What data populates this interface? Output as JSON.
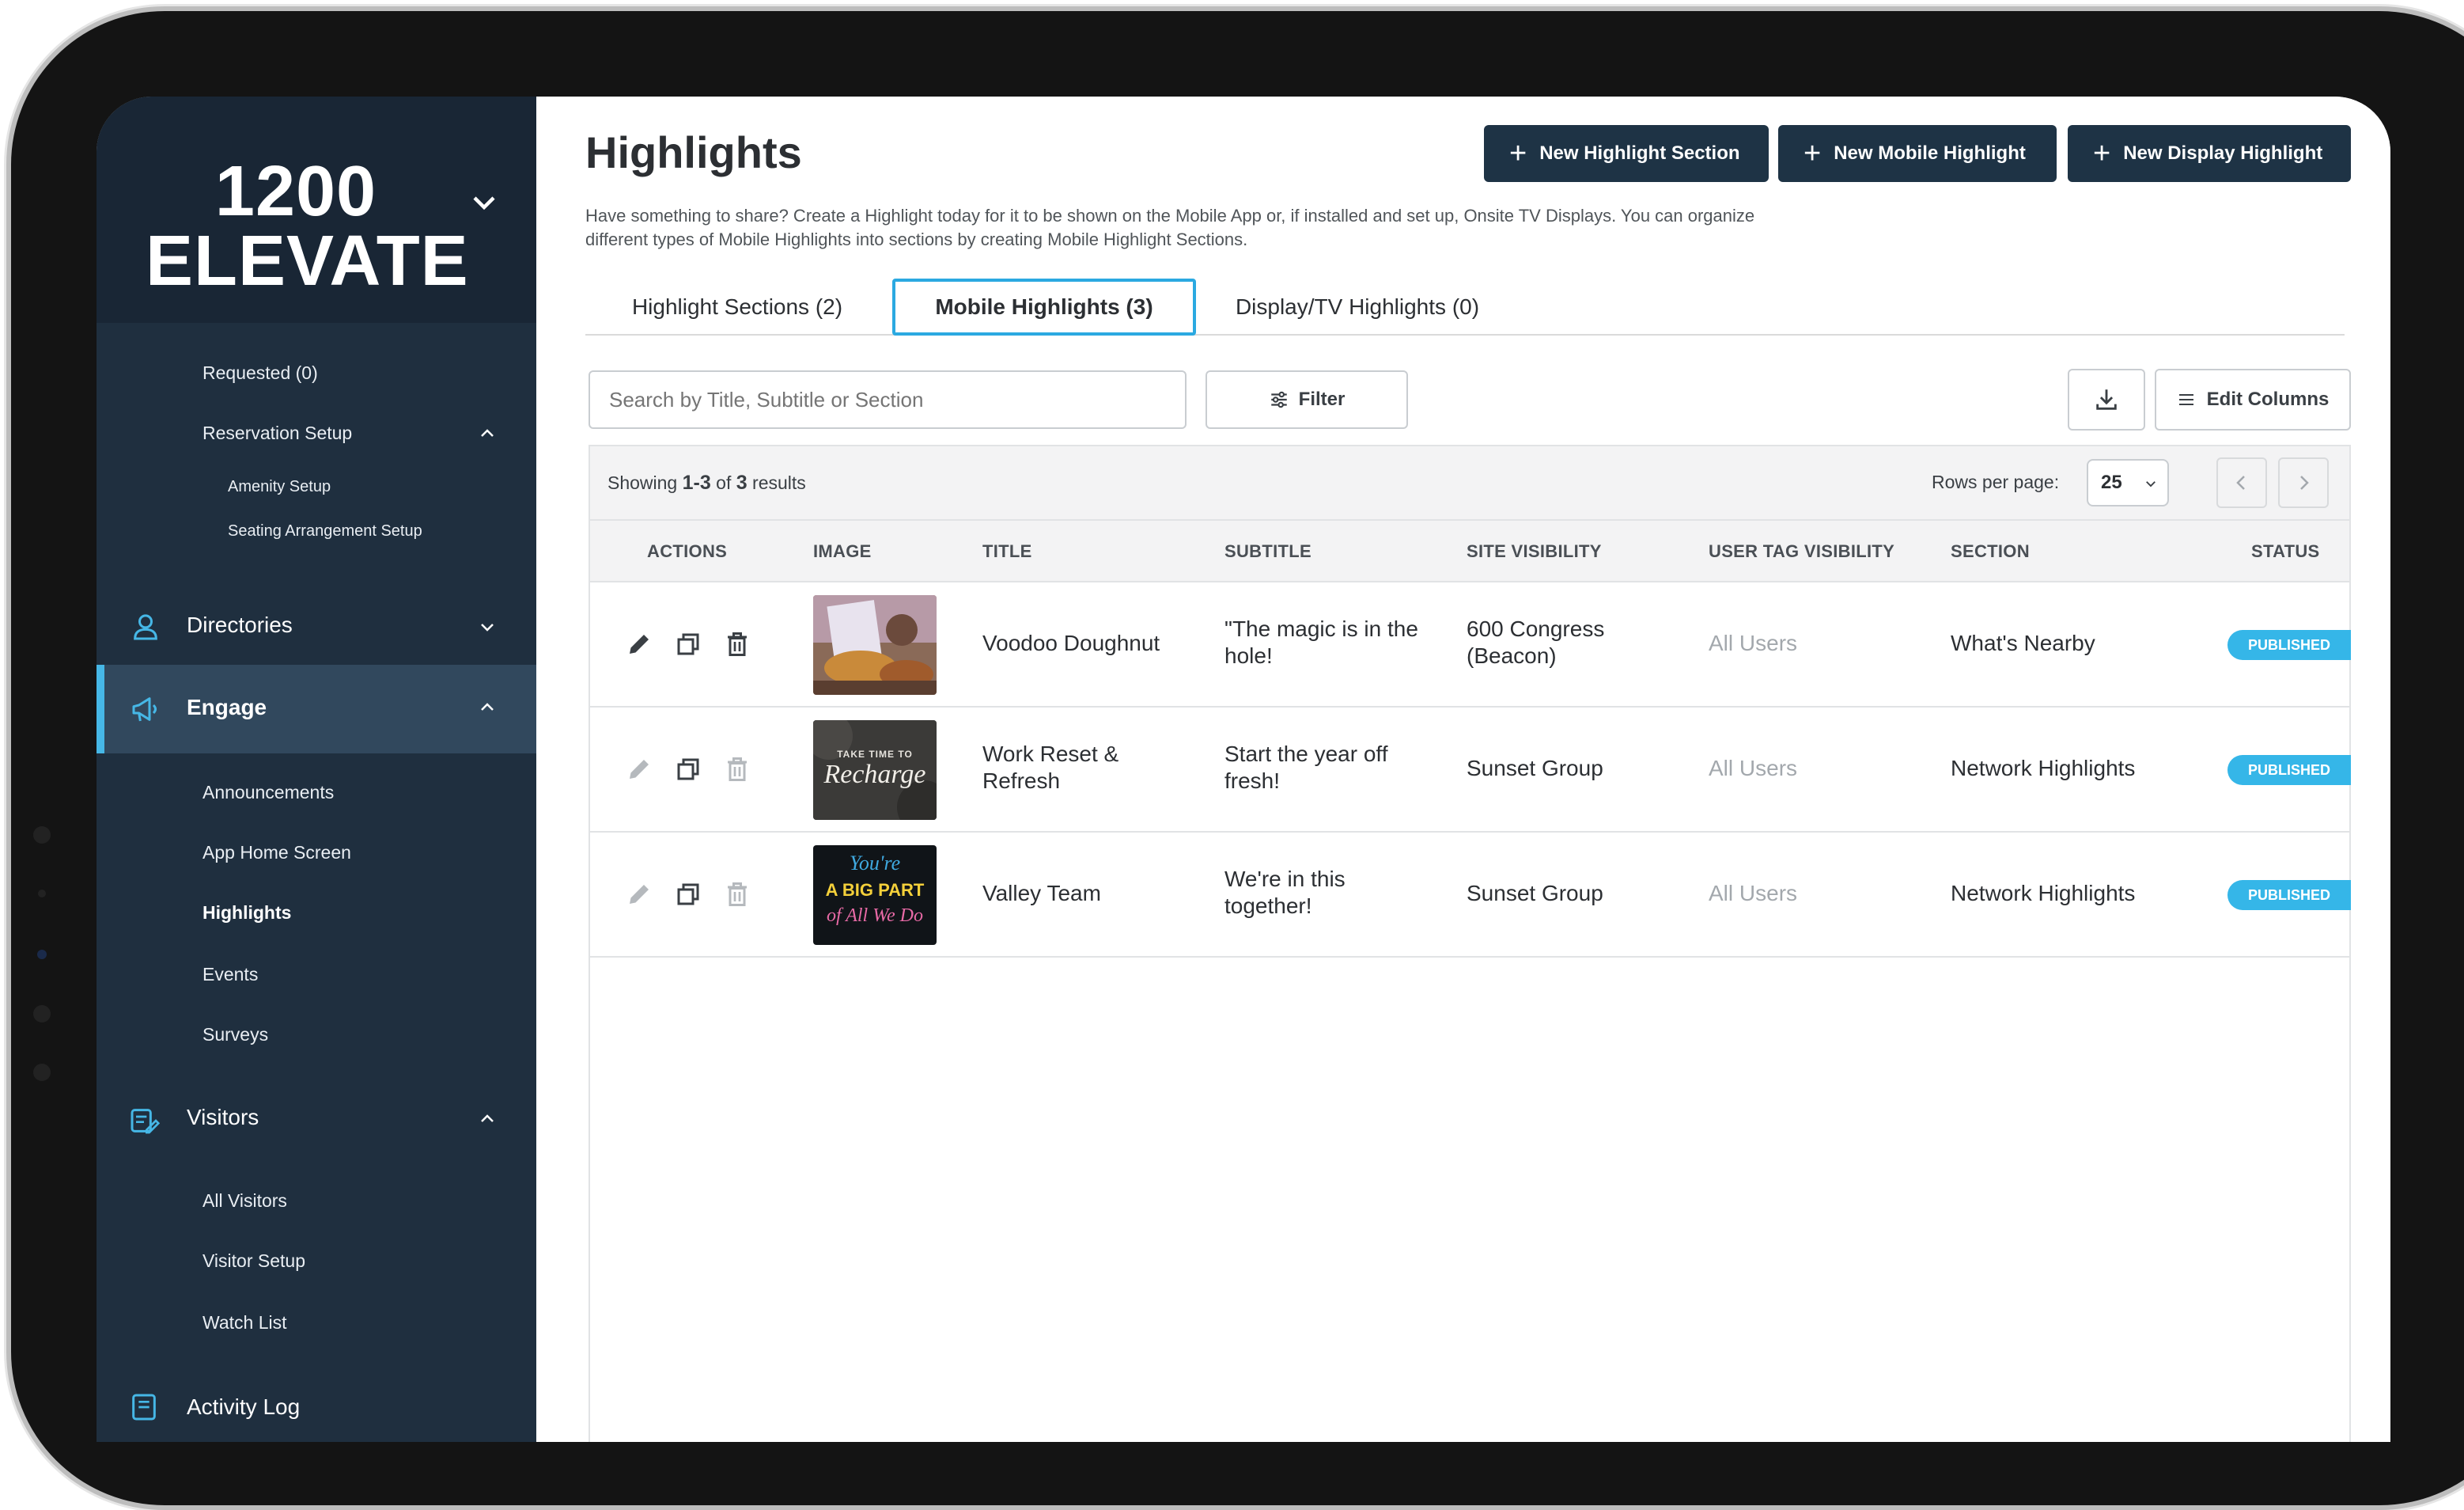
{
  "brand": {
    "line1": "1200",
    "line2": "ELEVATE"
  },
  "sidebar": {
    "items": [
      {
        "label": "Requested (0)",
        "level": "sub"
      },
      {
        "label": "Reservation Setup",
        "level": "sub",
        "caret": "up"
      },
      {
        "label": "Amenity Setup",
        "level": "subsub"
      },
      {
        "label": "Seating Arrangement Setup",
        "level": "subsub"
      },
      {
        "label": "Directories",
        "level": "main",
        "icon": "person-icon",
        "caret": "down"
      },
      {
        "label": "Engage",
        "level": "main",
        "icon": "megaphone-icon",
        "caret": "up",
        "active": true
      },
      {
        "label": "Announcements",
        "level": "sub"
      },
      {
        "label": "App Home Screen",
        "level": "sub"
      },
      {
        "label": "Highlights",
        "level": "sub",
        "current": true
      },
      {
        "label": "Events",
        "level": "sub"
      },
      {
        "label": "Surveys",
        "level": "sub"
      },
      {
        "label": "Visitors",
        "level": "main",
        "icon": "visitors-icon",
        "caret": "up"
      },
      {
        "label": "All Visitors",
        "level": "sub"
      },
      {
        "label": "Visitor Setup",
        "level": "sub"
      },
      {
        "label": "Watch List",
        "level": "sub"
      },
      {
        "label": "Activity Log",
        "level": "main",
        "icon": "log-icon"
      }
    ]
  },
  "header": {
    "title": "Highlights",
    "description": "Have something to share? Create a Highlight today for it to be shown on the Mobile App or, if installed and set up, Onsite TV Displays. You can organize different types of Mobile Highlights into sections by creating Mobile Highlight Sections.",
    "buttons": {
      "new_section": "New Highlight Section",
      "new_mobile": "New Mobile Highlight",
      "new_display": "New Display Highlight"
    }
  },
  "tabs": [
    {
      "label": "Highlight Sections (2)"
    },
    {
      "label": "Mobile Highlights (3)",
      "active": true
    },
    {
      "label": "Display/TV Highlights (0)"
    }
  ],
  "toolbar": {
    "search_placeholder": "Search by Title, Subtitle or Section",
    "filter_label": "Filter",
    "edit_columns_label": "Edit Columns"
  },
  "table": {
    "showing_prefix": "Showing",
    "showing_range": "1-3",
    "showing_of": "of",
    "showing_total": "3",
    "showing_suffix": "results",
    "rows_per_page_label": "Rows per page:",
    "rows_per_page_value": "25",
    "columns": [
      "ACTIONS",
      "IMAGE",
      "TITLE",
      "SUBTITLE",
      "SITE VISIBILITY",
      "USER TAG VISIBILITY",
      "SECTION",
      "STATUS"
    ],
    "rows": [
      {
        "title": "Voodoo Doughnut",
        "subtitle": "\"The magic is in the hole!",
        "site": "600 Congress (Beacon)",
        "tags": "All Users",
        "section": "What's Nearby",
        "status": "PUBLISHED"
      },
      {
        "title": "Work Reset & Refresh",
        "subtitle": "Start the year off fresh!",
        "site": "Sunset Group",
        "tags": "All Users",
        "section": "Network Highlights",
        "status": "PUBLISHED",
        "image_text": "Recharge",
        "image_top": "TAKE TIME TO"
      },
      {
        "title": "Valley Team",
        "subtitle": "We're in this together!",
        "site": "Sunset Group",
        "tags": "All Users",
        "section": "Network Highlights",
        "status": "PUBLISHED",
        "image_text_1": "You're",
        "image_text_2": "A BIG PART",
        "image_text_3": "of All We Do"
      }
    ]
  },
  "colors": {
    "sidebar": "#1f2f3f",
    "accent": "#46b7e6",
    "button": "#1e3345",
    "badge": "#35b6e8"
  }
}
